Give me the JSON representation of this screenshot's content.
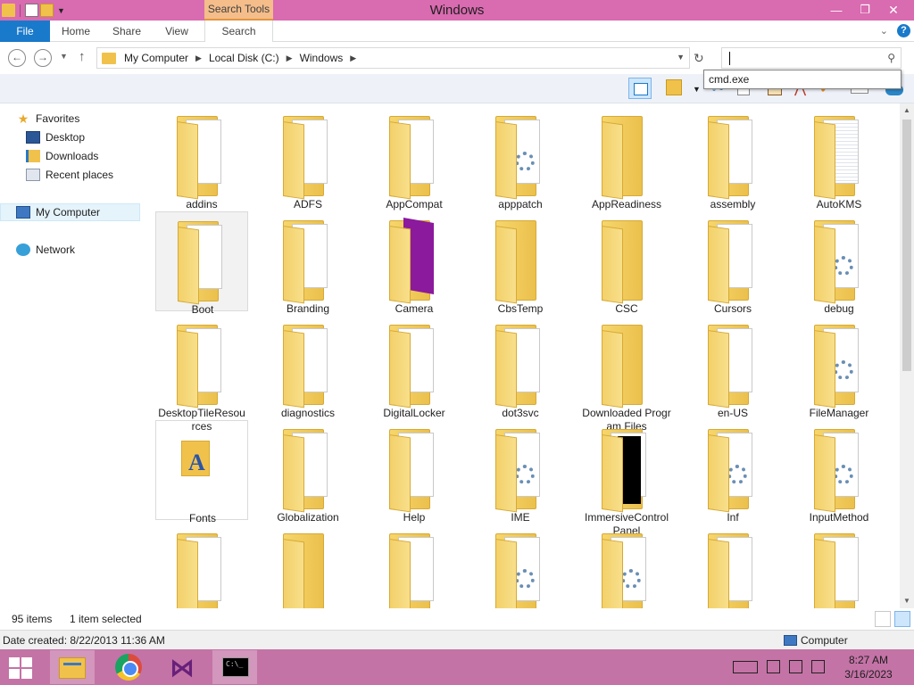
{
  "window": {
    "title": "Windows",
    "contextual_tab": "Search Tools"
  },
  "ribbon": {
    "tabs": [
      {
        "label": "File"
      },
      {
        "label": "Home"
      },
      {
        "label": "Share"
      },
      {
        "label": "View"
      },
      {
        "label": "Search"
      }
    ]
  },
  "address": {
    "crumbs": [
      "My Computer",
      "Local Disk (C:)",
      "Windows"
    ]
  },
  "search": {
    "value": "",
    "suggestion": "cmd.exe"
  },
  "nav": {
    "favorites": "Favorites",
    "desktop": "Desktop",
    "downloads": "Downloads",
    "recent": "Recent places",
    "computer": "My Computer",
    "network": "Network"
  },
  "items": [
    {
      "label": "addins",
      "icon": "folder-doc"
    },
    {
      "label": "ADFS",
      "icon": "folder-files"
    },
    {
      "label": "AppCompat",
      "icon": "folder-files"
    },
    {
      "label": "apppatch",
      "icon": "folder-gear"
    },
    {
      "label": "AppReadiness",
      "icon": "folder-empty"
    },
    {
      "label": "assembly",
      "icon": "folder-files"
    },
    {
      "label": "AutoKMS",
      "icon": "folder-lined"
    },
    {
      "label": "Boot",
      "icon": "folder-files"
    },
    {
      "label": "Branding",
      "icon": "folder-files"
    },
    {
      "label": "Camera",
      "icon": "folder-purple"
    },
    {
      "label": "CbsTemp",
      "icon": "folder-empty"
    },
    {
      "label": "CSC",
      "icon": "folder-empty"
    },
    {
      "label": "Cursors",
      "icon": "folder-doc"
    },
    {
      "label": "debug",
      "icon": "folder-gear"
    },
    {
      "label": "DesktopTileResources",
      "icon": "folder-doc"
    },
    {
      "label": "diagnostics",
      "icon": "folder-files"
    },
    {
      "label": "DigitalLocker",
      "icon": "folder-files"
    },
    {
      "label": "dot3svc",
      "icon": "folder-files"
    },
    {
      "label": "Downloaded Program Files",
      "icon": "folder-empty"
    },
    {
      "label": "en-US",
      "icon": "folder-doc"
    },
    {
      "label": "FileManager",
      "icon": "folder-gear"
    },
    {
      "label": "Fonts",
      "icon": "fonts-folder"
    },
    {
      "label": "Globalization",
      "icon": "folder-files"
    },
    {
      "label": "Help",
      "icon": "folder-files"
    },
    {
      "label": "IME",
      "icon": "folder-gear"
    },
    {
      "label": "ImmersiveControlPanel",
      "icon": "folder-black"
    },
    {
      "label": "Inf",
      "icon": "folder-gear"
    },
    {
      "label": "InputMethod",
      "icon": "folder-gear"
    },
    {
      "label": "",
      "icon": "folder-doc"
    },
    {
      "label": "",
      "icon": "folder-empty"
    },
    {
      "label": "",
      "icon": "folder-files"
    },
    {
      "label": "",
      "icon": "folder-gear"
    },
    {
      "label": "",
      "icon": "folder-gear"
    },
    {
      "label": "",
      "icon": "folder-files"
    },
    {
      "label": "",
      "icon": "folder-files"
    }
  ],
  "selected_item": "Boot",
  "status": {
    "count": "95 items",
    "selection": "1 item selected"
  },
  "details": {
    "date_created": "Date created: 8/22/2013 11:36 AM",
    "location": "Computer"
  },
  "taskbar": {
    "apps": [
      "file-explorer-icon",
      "chrome-icon",
      "visual-studio-icon",
      "cmd-icon"
    ],
    "time": "8:27 AM",
    "date": "3/16/2023"
  },
  "colors": {
    "titlebar": "#d96bb0",
    "taskbar": "#c473a6",
    "file_tab": "#1979ca",
    "contextual_tab": "#f4bd8a"
  }
}
